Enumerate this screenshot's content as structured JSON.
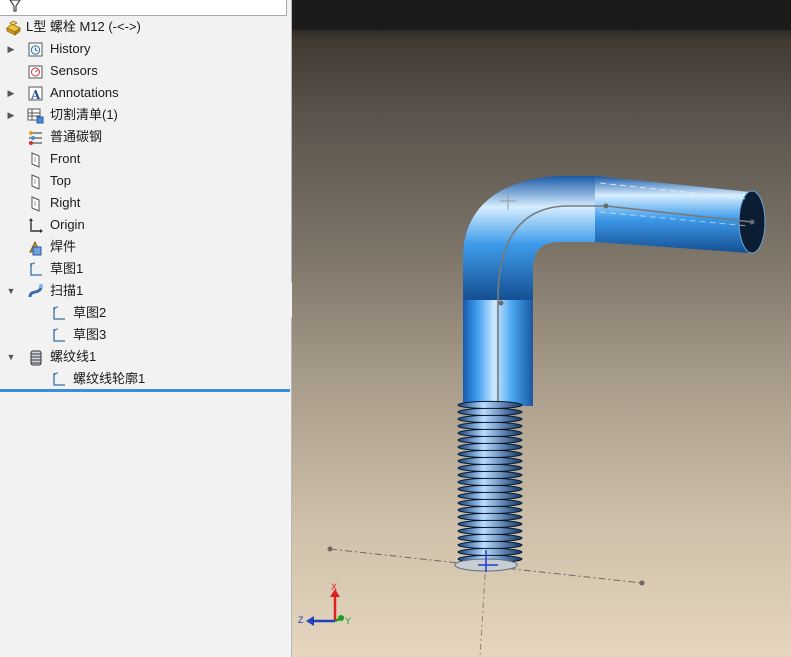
{
  "feature_tree": {
    "part_name": "L型 螺栓 M12  (-<->)",
    "items": [
      {
        "label": "History",
        "icon": "history-icon",
        "expand": "collapsed"
      },
      {
        "label": "Sensors",
        "icon": "sensors-icon",
        "expand": "none"
      },
      {
        "label": "Annotations",
        "icon": "annotations-icon",
        "expand": "collapsed"
      },
      {
        "label": "切割清单(1)",
        "icon": "cut-list-icon",
        "expand": "collapsed"
      },
      {
        "label": "普通碳钢",
        "icon": "material-icon",
        "expand": "none"
      },
      {
        "label": "Front",
        "icon": "plane-icon",
        "expand": "none"
      },
      {
        "label": "Top",
        "icon": "plane-icon",
        "expand": "none"
      },
      {
        "label": "Right",
        "icon": "plane-icon",
        "expand": "none"
      },
      {
        "label": "Origin",
        "icon": "origin-icon",
        "expand": "none"
      },
      {
        "label": "焊件",
        "icon": "weldment-icon",
        "expand": "none"
      },
      {
        "label": "草图1",
        "icon": "sketch-icon",
        "expand": "none"
      },
      {
        "label": "扫描1",
        "icon": "sweep-icon",
        "expand": "expanded"
      },
      {
        "label": "草图2",
        "icon": "sketch-icon",
        "expand": "none",
        "child": true
      },
      {
        "label": "草图3",
        "icon": "sketch-icon",
        "expand": "none",
        "child": true
      },
      {
        "label": "螺纹线1",
        "icon": "thread-icon",
        "expand": "expanded"
      },
      {
        "label": "螺纹线轮廓1",
        "icon": "sketch-icon",
        "expand": "none",
        "child": true
      }
    ]
  },
  "triad": {
    "x_label": "X",
    "y_label": "Y",
    "z_label": "Z"
  },
  "colors": {
    "panel_bg": "#f2f2f2",
    "rollback_bar": "#3b8fd6",
    "part_blue": "#2f86dd",
    "axis_x": "#e02020",
    "axis_y": "#20a020",
    "axis_z": "#2040c0"
  }
}
